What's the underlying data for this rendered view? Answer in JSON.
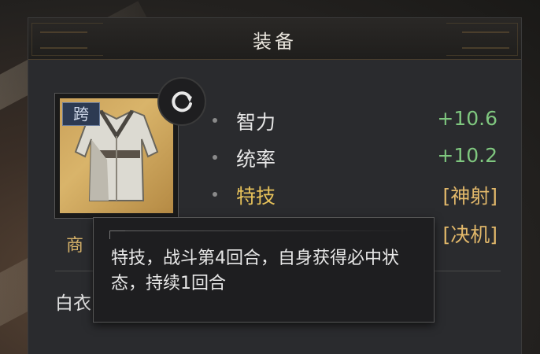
{
  "header": {
    "title": "装备"
  },
  "item": {
    "tag": "跨",
    "rarity_label": "商",
    "name_partial": "白衣"
  },
  "stats": [
    {
      "label": "智力",
      "value": "+10.6"
    },
    {
      "label": "统率",
      "value": "+10.2"
    },
    {
      "label": "特技",
      "value": "[神射]"
    },
    {
      "label": "",
      "value": "[决机]"
    }
  ],
  "tooltip": {
    "text": "特技，战斗第4回合，自身获得必中状态，持续1回合"
  },
  "colors": {
    "positive": "#7fc77f",
    "skill": "#e6c15a",
    "panel": "#2a2b2e"
  },
  "icons": {
    "refresh": "refresh-icon",
    "robe": "robe-icon"
  }
}
